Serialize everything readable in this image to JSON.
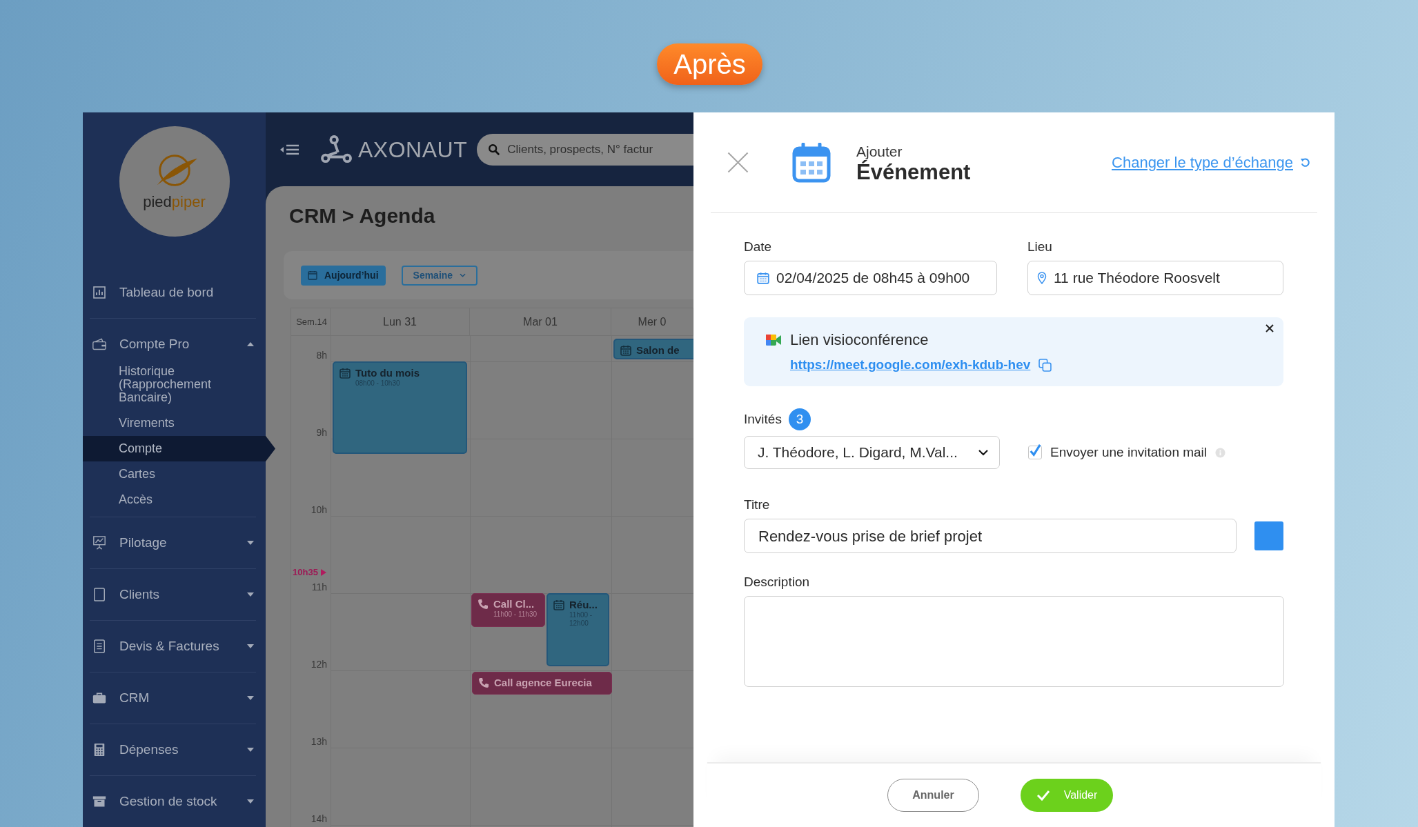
{
  "badge": "Après",
  "sidebar": {
    "logo": {
      "text_dark": "pied",
      "text_accent": "piper"
    },
    "items": [
      {
        "label": "Tableau de bord",
        "kind": "link"
      },
      {
        "label": "Compte Pro",
        "kind": "group",
        "expanded": true,
        "children": [
          {
            "label": "Historique (Rapprochement Bancaire)",
            "selected": false
          },
          {
            "label": "Virements",
            "selected": false
          },
          {
            "label": "Compte",
            "selected": true
          },
          {
            "label": "Cartes",
            "selected": false
          },
          {
            "label": "Accès",
            "selected": false
          }
        ]
      },
      {
        "label": "Pilotage",
        "kind": "group",
        "expanded": false
      },
      {
        "label": "Clients",
        "kind": "group",
        "expanded": false
      },
      {
        "label": "Devis & Factures",
        "kind": "group",
        "expanded": false
      },
      {
        "label": "CRM",
        "kind": "group",
        "expanded": false
      },
      {
        "label": "Dépenses",
        "kind": "group",
        "expanded": false
      },
      {
        "label": "Gestion de stock",
        "kind": "group",
        "expanded": false
      }
    ]
  },
  "topbar": {
    "logo": "AXONAUT",
    "search": {
      "placeholder": "Clients, prospects, N° factur"
    }
  },
  "agenda": {
    "title": "CRM > Agenda",
    "today_button": "Aujourd’hui",
    "view_select": "Semaine",
    "week": "Sem.14",
    "days": [
      "Lun 31",
      "Mar 01",
      "Mer 0"
    ],
    "hours": [
      "8h",
      "9h",
      "10h",
      "11h",
      "12h",
      "13h",
      "14h"
    ],
    "now": "10h35",
    "events": [
      {
        "kind": "event",
        "title": "Tuto du mois",
        "time": "08h00 - 10h30"
      },
      {
        "kind": "event",
        "title": "Salon de"
      },
      {
        "kind": "call",
        "title": "Call Cl...",
        "time": "11h00 - 11h30"
      },
      {
        "kind": "event",
        "title": "Réu...",
        "time": "11h00 - 12h00"
      },
      {
        "kind": "call",
        "title": "Call agence Eurecia"
      }
    ]
  },
  "modal": {
    "subtitle": "Ajouter",
    "title": "Événement",
    "change_link": "Changer le type d’échange",
    "date": {
      "label": "Date",
      "value": "02/04/2025 de 08h45 à 09h00"
    },
    "place": {
      "label": "Lieu",
      "value": "11 rue Théodore Roosvelt"
    },
    "visio": {
      "label": "Lien visioconférence",
      "url": "https://meet.google.com/exh-kdub-hev"
    },
    "guests": {
      "label": "Invités",
      "count": "3",
      "value": "J. Théodore, L. Digard, M.Val..."
    },
    "invite": {
      "label": "Envoyer une invitation mail",
      "checked": true
    },
    "titre": {
      "label": "Titre",
      "value": "Rendez-vous prise de brief projet",
      "color": "#2f8ff0"
    },
    "description": {
      "label": "Description"
    },
    "buttons": {
      "cancel": "Annuler",
      "confirm": "Valider"
    }
  }
}
